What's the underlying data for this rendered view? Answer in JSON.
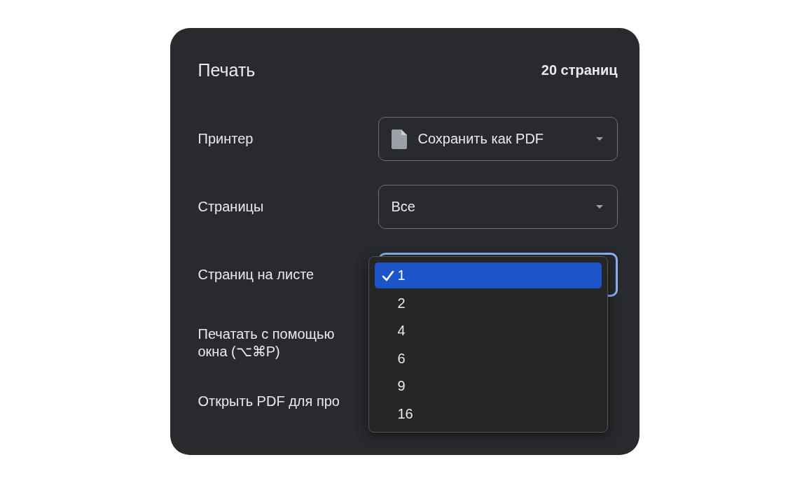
{
  "dialog": {
    "title": "Печать",
    "page_count": "20 страниц"
  },
  "settings": [
    {
      "kind": "select",
      "label": "Принтер",
      "value": "Сохранить как PDF",
      "focused": false
    },
    {
      "kind": "select",
      "label": "Страницы",
      "value": "Все",
      "focused": false
    },
    {
      "kind": "select",
      "label": "Страниц на листе",
      "focused": true
    },
    {
      "kind": "option",
      "label": "Печатать с помощью\nокна (⌥⌘P)"
    },
    {
      "kind": "option",
      "label": "Открыть PDF для про"
    }
  ],
  "menu": {
    "options": [
      {
        "label": "1",
        "selected": true
      },
      {
        "label": "2",
        "selected": false
      },
      {
        "label": "4",
        "selected": false
      },
      {
        "label": "6",
        "selected": false
      },
      {
        "label": "9",
        "selected": false
      },
      {
        "label": "16",
        "selected": false
      }
    ]
  }
}
